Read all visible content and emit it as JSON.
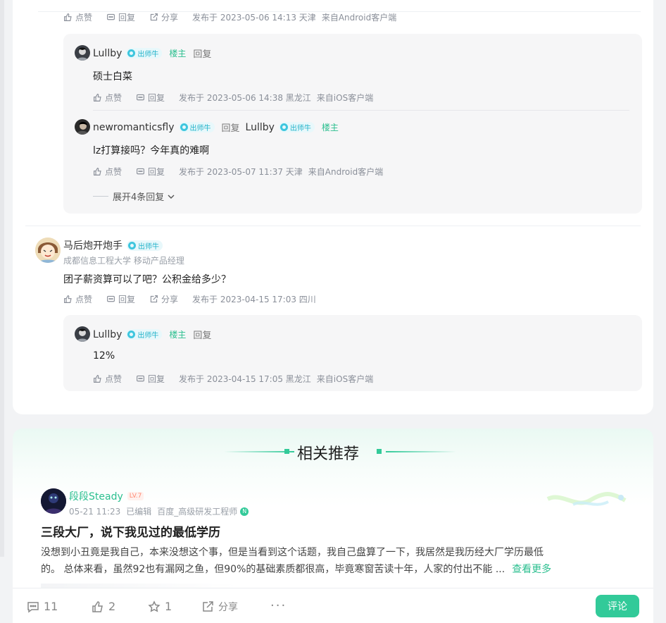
{
  "common": {
    "like": "点赞",
    "reply": "回复",
    "share": "分享",
    "badge": "出师牛",
    "op": "楼主",
    "reply_word": "回复"
  },
  "comment1": {
    "time": "发布于 2023-05-06 14:13 天津",
    "client": "来自Android客户端",
    "replies": [
      {
        "user": "Lullby",
        "text": "硕士白菜",
        "time": "发布于 2023-05-06 14:38 黑龙江",
        "client": "来自iOS客户端"
      },
      {
        "user": "newromanticsfly",
        "target": "Lullby",
        "text": "lz打算接吗？今年真的难啊",
        "time": "发布于 2023-05-07 11:37 天津",
        "client": "来自Android客户端"
      }
    ],
    "expand": "展开4条回复"
  },
  "comment2": {
    "user": "马后炮开炮手",
    "subtitle": "成都信息工程大学 移动产品经理",
    "text": "团子薪资算可以了吧？公积金给多少？",
    "time": "发布于 2023-04-15 17:03 四川",
    "reply": {
      "user": "Lullby",
      "text": "12%",
      "time": "发布于 2023-04-15 17:05 黑龙江",
      "client": "来自iOS客户端"
    }
  },
  "recommend": {
    "heading": "相关推荐",
    "post": {
      "author": "段段Steady",
      "level": "LV.7",
      "date": "05-21 11:23",
      "edited": "已编辑",
      "role": "百度_高级研发工程师",
      "title": "三段大厂，说下我见过的最低学历",
      "body_line1": "没想到小丑竟是我自己，本来没想这个事，但是当看到这个话题，我自己盘算了一下，我居然是我历经大厂学历最低",
      "body_line2": "的。 总体来看，虽然92也有漏网之鱼，但90%的基础素质都很高，毕竟寒窗苦读十年，人家的付出不能 ...",
      "more": "查看更多"
    }
  },
  "bottom": {
    "comments": "11",
    "likes": "2",
    "stars": "1",
    "share": "分享",
    "comment_button": "评论"
  },
  "colors": {
    "accent": "#32ca99",
    "badge": "#1fb1c9",
    "op": "#2bbf8f"
  }
}
